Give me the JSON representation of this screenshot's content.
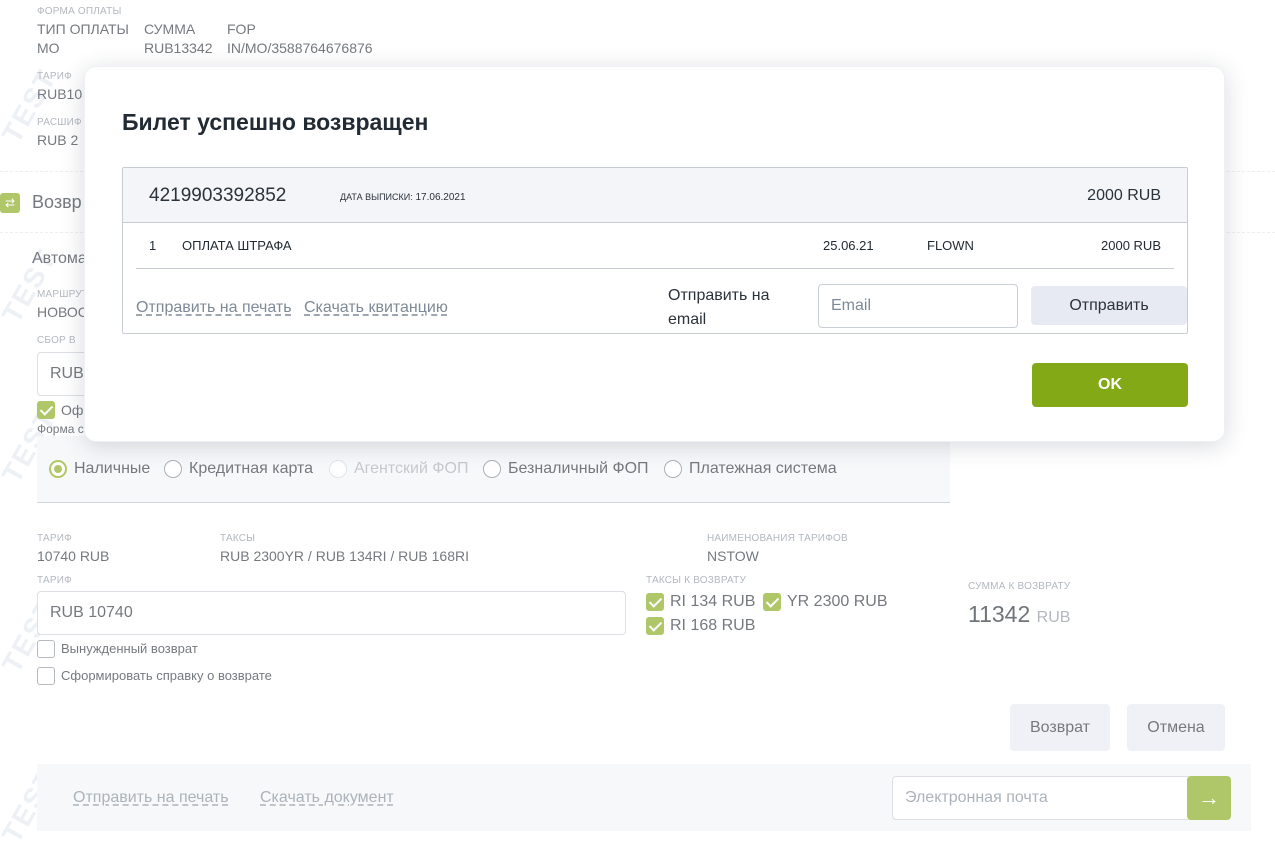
{
  "payment_form": {
    "section_label": "ФОРМА ОПЛАТЫ",
    "col1_header": "ТИП ОПЛАТЫ",
    "col1_value": "MO",
    "col2_header": "СУММА",
    "col2_value": "RUB13342",
    "col3_header": "FOP",
    "col3_value": "IN/MO/3588764676876"
  },
  "upper": {
    "tariff_label": "ТАРИФ",
    "tariff_value": "RUB10",
    "breakdown_label": "РАСШИФ",
    "breakdown_value": "RUB  2"
  },
  "return_section": {
    "title": "Возвр",
    "auto_label": "Автома",
    "route_label": "МАРШРУТ",
    "route_value": "НОВОС",
    "fee_label": "СБОР В",
    "fee_input": "RUB",
    "issue_checkbox": "Оф",
    "payment_form_label": "Форма с"
  },
  "payment_options": [
    {
      "label": "Наличные",
      "state": "selected"
    },
    {
      "label": "Кредитная карта",
      "state": "normal"
    },
    {
      "label": "Агентский ФОП",
      "state": "disabled"
    },
    {
      "label": "Безналичный ФОП",
      "state": "normal"
    },
    {
      "label": "Платежная система",
      "state": "normal"
    }
  ],
  "fare": {
    "tariff_label": "ТАРИФ",
    "tariff_value": "10740 RUB",
    "taxes_label": "ТАКСЫ",
    "taxes_value": "RUB 2300YR / RUB 134RI / RUB 168RI",
    "fare_names_label": "НАИМЕНОВАНИЯ ТАРИФОВ",
    "fare_names_value": "NSTOW",
    "tariff_input_label": "ТАРИФ",
    "tariff_input_value": "RUB 10740",
    "refund_taxes_label": "ТАКСЫ К ВОЗВРАТУ",
    "tax_ri_134": "RI 134 RUB",
    "tax_yr_2300": "YR 2300 RUB",
    "tax_ri_168": "RI 168 RUB",
    "forced_return": "Вынужденный   возврат",
    "make_certificate": "Сформировать справку о возврате",
    "refund_sum_label": "СУММА К ВОЗВРАТУ",
    "refund_sum_value": "11342",
    "refund_sum_currency": "RUB"
  },
  "actions": {
    "return_button": "Возврат",
    "cancel_button": "Отмена",
    "print_link": "Отправить на печать",
    "download_link": "Скачать документ",
    "email_placeholder": "Электронная почта",
    "arrow": "→"
  },
  "watermark": "TEST",
  "modal": {
    "title": "Билет успешно возвращен",
    "ticket_number": "4219903392852",
    "issue_date_label": "ДАТА ВЫПИСКИ:",
    "issue_date": "17.06.2021",
    "total": "2000 RUB",
    "row": {
      "index": "1",
      "name": "ОПЛАТА ШТРАФА",
      "date": "25.06.21",
      "status": "FLOWN",
      "amount": "2000 RUB"
    },
    "print_link": "Отправить на печать",
    "receipt_link": "Скачать квитанцию",
    "send_email_label": "Отправить на email",
    "email_placeholder": "Email",
    "send_button": "Отправить",
    "ok_button": "OK"
  },
  "colors": {
    "accent": "#84a917",
    "panel": "#f3f5f8",
    "button_grey": "#e7eaf2"
  }
}
